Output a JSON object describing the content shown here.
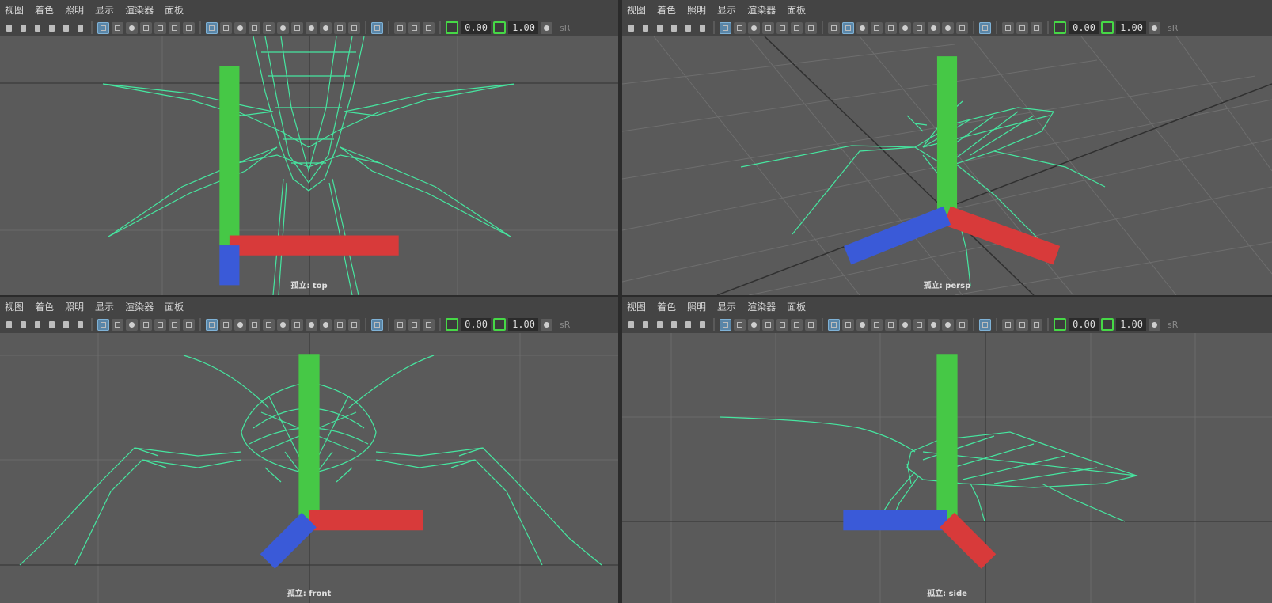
{
  "menu": [
    "视图",
    "着色",
    "照明",
    "显示",
    "渲染器",
    "面板"
  ],
  "toolbar": {
    "exposure": "0.00",
    "gamma": "1.00",
    "colorspace": "sR"
  },
  "panes": [
    {
      "label": "孤立: top"
    },
    {
      "label": "孤立: persp"
    },
    {
      "label": "孤立: front"
    },
    {
      "label": "孤立: side"
    }
  ],
  "colors": {
    "wire": "#46e6a0",
    "grid": "#6c6c6c",
    "axis_line": "#303030",
    "bg": "#5a5a5a"
  },
  "icons": {
    "axis-gizmo": "xyz-triad"
  }
}
